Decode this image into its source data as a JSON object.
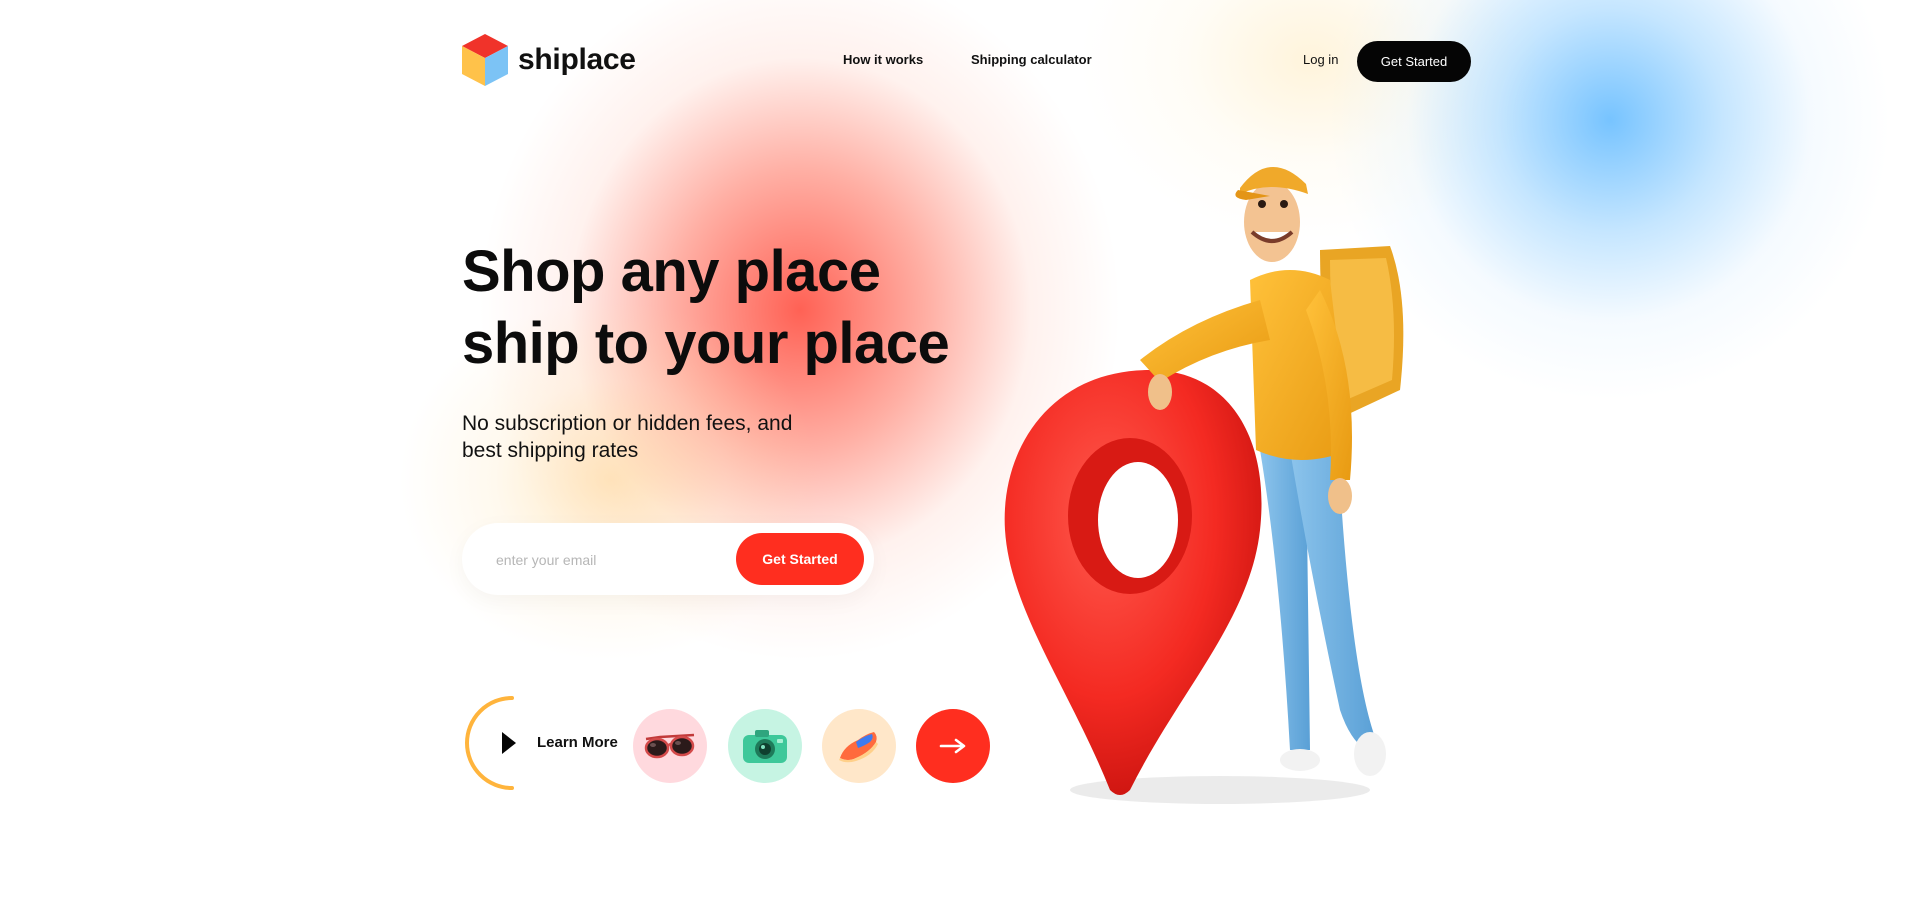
{
  "brand": {
    "name": "shiplace",
    "logo_icon": "cube-logo-icon",
    "colors": {
      "accent": "#ff2e1f",
      "dark": "#050505",
      "cube_red": "#f0332a",
      "cube_yellow": "#ffc24a",
      "cube_blue": "#7cc3f5"
    }
  },
  "nav": {
    "items": [
      {
        "label": "How it works"
      },
      {
        "label": "Shipping calculator"
      }
    ],
    "login_label": "Log in",
    "cta_label": "Get Started"
  },
  "hero": {
    "title_line1": "Shop any place",
    "title_line2": "ship to your place",
    "subtitle_line1": "No subscription or hidden fees, and",
    "subtitle_line2": "best shipping rates",
    "email": {
      "placeholder": "enter your email",
      "value": "",
      "button_label": "Get Started"
    }
  },
  "actions": {
    "learn_more_label": "Learn More",
    "learn_more_icon": "play-icon",
    "products": [
      {
        "icon": "sunglasses-icon",
        "bg": "#ffd9de"
      },
      {
        "icon": "camera-icon",
        "bg": "#c6f4e3"
      },
      {
        "icon": "sneaker-icon",
        "bg": "#ffe7c9"
      }
    ],
    "next_icon": "arrow-right-icon"
  },
  "illustration": {
    "icon": "delivery-man-with-location-pin-illustration"
  }
}
